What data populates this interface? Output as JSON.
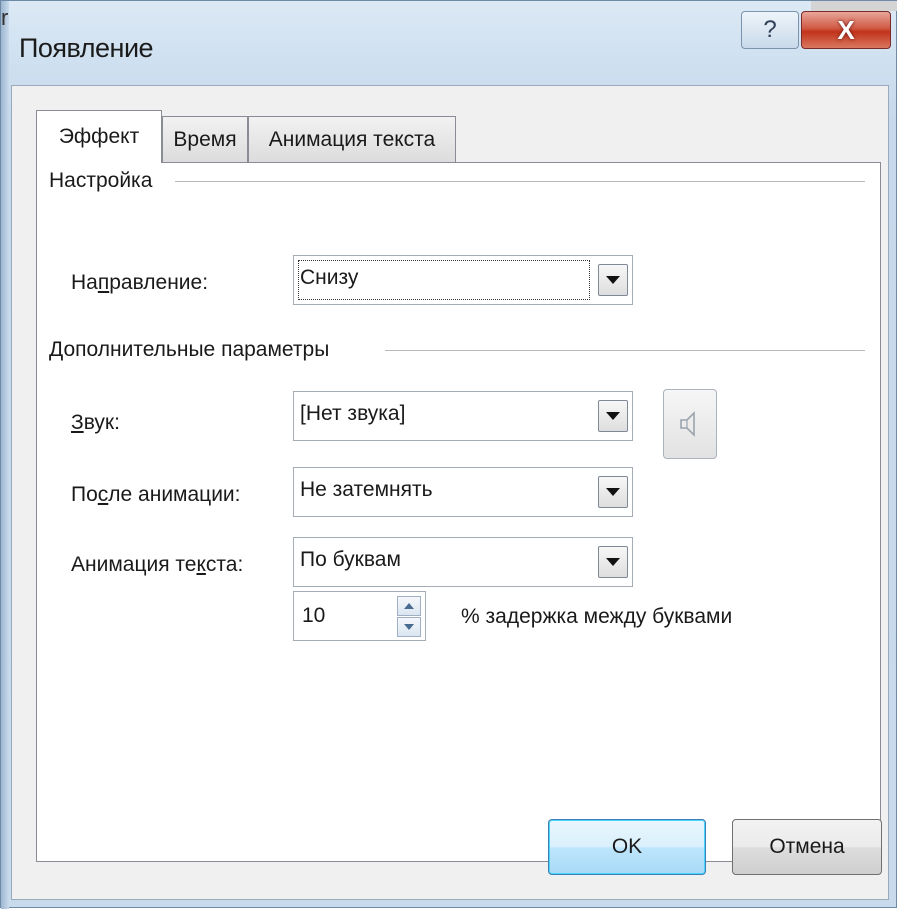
{
  "window": {
    "title": "Появление",
    "help_glyph": "?",
    "close_glyph": "X",
    "corner_mark": "r"
  },
  "tabs": [
    {
      "label": "Эффект",
      "selected": true
    },
    {
      "label": "Время",
      "selected": false
    },
    {
      "label": "Анимация текста",
      "selected": false
    }
  ],
  "settings_group": {
    "title": "Настройка",
    "direction": {
      "label_pre": "На",
      "label_mnemonic": "п",
      "label_post": "равление:",
      "value": "Снизу"
    }
  },
  "extra_group": {
    "title": "Дополнительные параметры",
    "sound": {
      "label_mnemonic": "З",
      "label_post": "вук:",
      "value": "[Нет звука]",
      "icon": "speaker-icon"
    },
    "after_animation": {
      "label_pre": "По",
      "label_mnemonic": "с",
      "label_post": "ле анимации:",
      "value": "Не затемнять"
    },
    "text_animation": {
      "label_pre": "Анимация те",
      "label_mnemonic": "к",
      "label_post": "ста:",
      "value": "По буквам"
    },
    "delay": {
      "value": "10",
      "label_pre": "% за",
      "label_mnemonic": "д",
      "label_post": "ержка между буквами"
    }
  },
  "buttons": {
    "ok": "OK",
    "cancel": "Отмена"
  },
  "colors": {
    "frame": "#c8dbed",
    "close_button": "#c2331b",
    "default_button_border": "#3c7fb1"
  }
}
